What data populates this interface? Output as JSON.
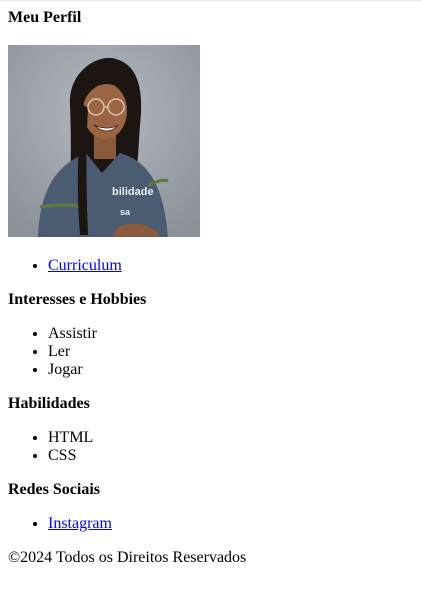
{
  "profile": {
    "title": "Meu Perfil",
    "photo_alt": "Foto de perfil",
    "links": [
      {
        "label": "Curriculum"
      }
    ]
  },
  "interests": {
    "title": "Interesses e Hobbies",
    "items": [
      "Assistir",
      "Ler",
      "Jogar"
    ]
  },
  "skills": {
    "title": "Habilidades",
    "items": [
      "HTML",
      "CSS"
    ]
  },
  "social": {
    "title": "Redes Sociais",
    "links": [
      {
        "label": "Instagram"
      }
    ]
  },
  "footer": {
    "text": "©2024 Todos os Direitos Reservados"
  },
  "colors": {
    "link": "#0000ee",
    "photo_bg": "#9a9ea8",
    "shirt": "#4a5b72"
  }
}
